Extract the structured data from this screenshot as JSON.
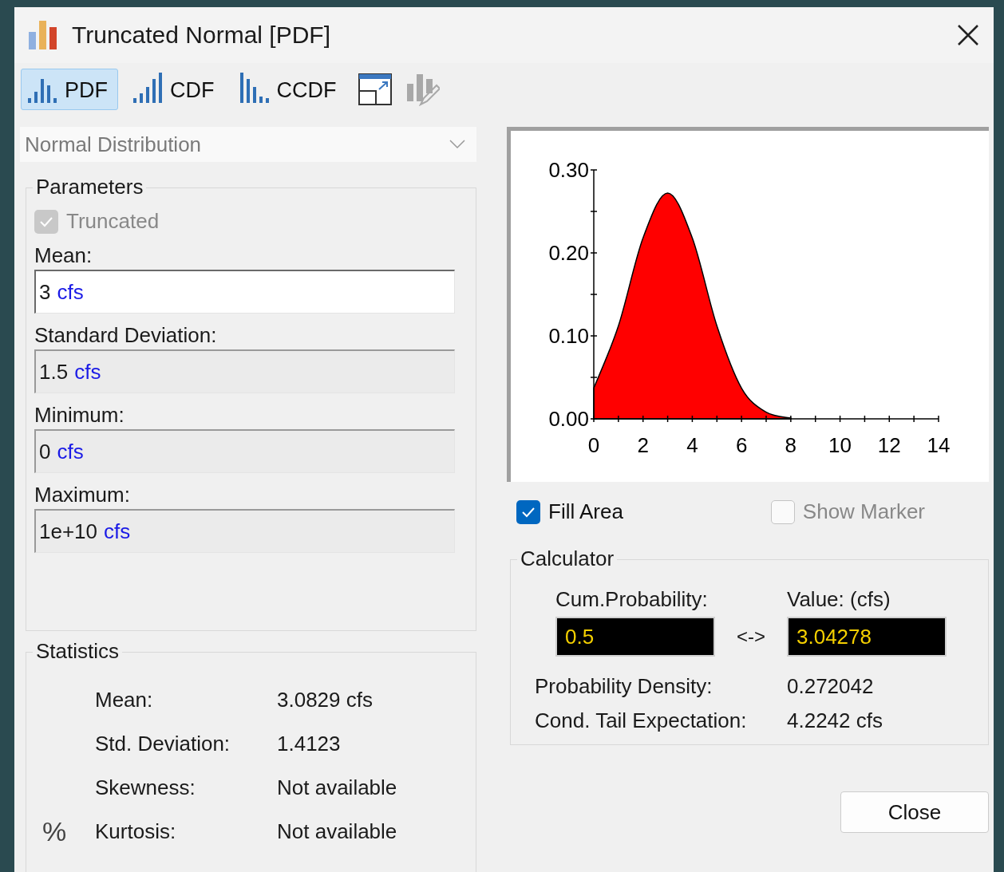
{
  "window": {
    "title": "Truncated Normal [PDF]"
  },
  "toolbar": {
    "tabs": [
      {
        "label": "PDF",
        "selected": true
      },
      {
        "label": "CDF",
        "selected": false
      },
      {
        "label": "CCDF",
        "selected": false
      }
    ],
    "actions": [
      {
        "kind": "popout",
        "disabled": false
      },
      {
        "kind": "edit",
        "disabled": true
      }
    ]
  },
  "distribution": {
    "value": "Normal Distribution",
    "disabled": true
  },
  "parameters": {
    "title": "Parameters",
    "truncated": {
      "label": "Truncated",
      "checked": true,
      "disabled": true
    },
    "fields": [
      {
        "label": "Mean:",
        "value": "3",
        "unit": "cfs",
        "focused": true
      },
      {
        "label": "Standard Deviation:",
        "value": "1.5",
        "unit": "cfs",
        "focused": false
      },
      {
        "label": "Minimum:",
        "value": "0",
        "unit": "cfs",
        "focused": false
      },
      {
        "label": "Maximum:",
        "value": "1e+10",
        "unit": "cfs",
        "focused": false
      }
    ]
  },
  "statistics": {
    "title": "Statistics",
    "rows": [
      {
        "label": "Mean:",
        "value": "3.0829 cfs"
      },
      {
        "label": "Std. Deviation:",
        "value": "1.4123"
      },
      {
        "label": "Skewness:",
        "value": "Not available"
      },
      {
        "label": "Kurtosis:",
        "value": "Not available",
        "mark": "%"
      }
    ]
  },
  "chart": {
    "chart_data": {
      "type": "area",
      "x": [
        0,
        1,
        2,
        3,
        4,
        5,
        6,
        7,
        8
      ],
      "series": [
        {
          "color": "#ff0000",
          "values": [
            0.037,
            0.112,
            0.218,
            0.272,
            0.218,
            0.112,
            0.037,
            0.008,
            0.001
          ]
        }
      ],
      "xlim": [
        0,
        14
      ],
      "ylim": [
        0,
        0.3
      ],
      "xticks": [
        0,
        2,
        4,
        6,
        8,
        10,
        12,
        14
      ],
      "yticks": [
        {
          "value": 0,
          "label": "0.00"
        },
        {
          "value": 0.1,
          "label": "0.10"
        },
        {
          "value": 0.2,
          "label": "0.20"
        },
        {
          "value": 0.3,
          "label": "0.30"
        }
      ]
    }
  },
  "options": [
    {
      "label": "Fill Area",
      "checked": true,
      "disabled": false
    },
    {
      "label": "Show Marker",
      "checked": false,
      "disabled": true
    }
  ],
  "calculator": {
    "title": "Calculator",
    "probability_label": "Cum.Probability:",
    "probability": "0.5",
    "swap": "<->",
    "value_label": "Value: (cfs)",
    "value": "3.04278",
    "results": [
      {
        "label": "Probability Density:",
        "value": "0.272042"
      },
      {
        "label": "Cond. Tail Expectation:",
        "value": "4.2242 cfs"
      }
    ]
  },
  "buttons": [
    {
      "label": "Close"
    }
  ]
}
